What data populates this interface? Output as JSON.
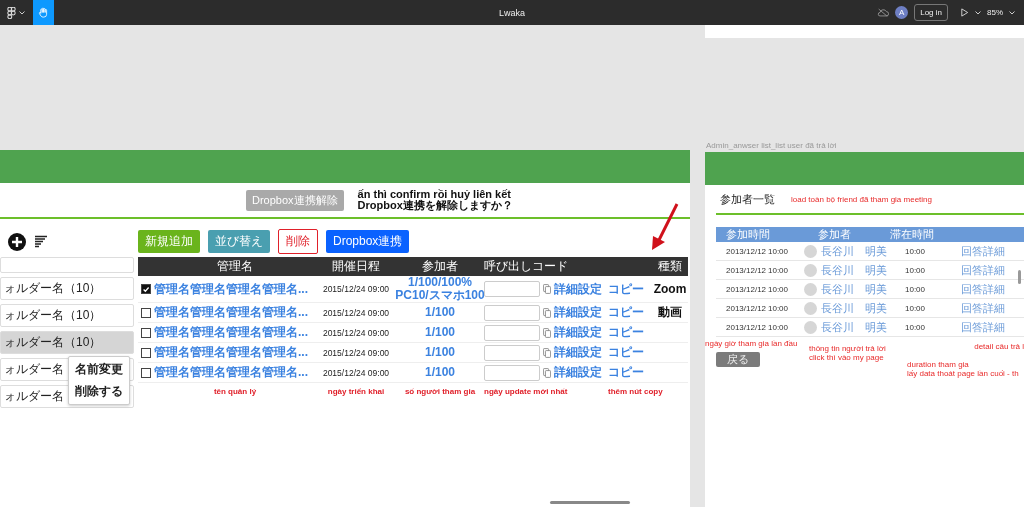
{
  "topbar": {
    "hand_tool": {
      "selected": true
    },
    "title": "Lwaka",
    "avatar": "A",
    "login": "Log in",
    "zoom": "85%"
  },
  "left_frame": {
    "unlink_button": "Dropbox連携解除",
    "note": [
      "ấn thì confirm rồi huỷ liên kết",
      "Dropbox連携を解除しますか？"
    ],
    "actions": [
      {
        "label": "新規追加",
        "kind": "add"
      },
      {
        "label": "並び替え",
        "kind": "sort"
      },
      {
        "label": "削除",
        "kind": "delete"
      },
      {
        "label": "Dropbox連携",
        "kind": "dropbox"
      }
    ],
    "folders": [
      {
        "label": "ォルダー名（10）",
        "selected": false
      },
      {
        "label": "ォルダー名（10）",
        "selected": false
      },
      {
        "label": "ォルダー名（10）",
        "selected": true
      },
      {
        "label": "ォルダー名",
        "selected": false
      },
      {
        "label": "ォルダー名",
        "selected": false
      }
    ],
    "context_menu": [
      "名前変更",
      "削除する"
    ],
    "table": {
      "columns": [
        "管理名",
        "開催日程",
        "参加者",
        "呼び出しコード",
        "種類"
      ],
      "rows": [
        {
          "checked": true,
          "name": "管理名管理名管理名管理名...",
          "date": "2015/12/24 09:00",
          "participants": [
            "1/100/100%",
            "PC10/スマホ100"
          ],
          "settings": "詳細設定",
          "copy": "コピー",
          "type": "Zoom"
        },
        {
          "checked": false,
          "name": "管理名管理名管理名管理名...",
          "date": "2015/12/24 09:00",
          "participants": [
            "1/100"
          ],
          "settings": "詳細設定",
          "copy": "コピー",
          "type": "動画"
        },
        {
          "checked": false,
          "name": "管理名管理名管理名管理名...",
          "date": "2015/12/24 09:00",
          "participants": [
            "1/100"
          ],
          "settings": "詳細設定",
          "copy": "コピー"
        },
        {
          "checked": false,
          "name": "管理名管理名管理名管理名...",
          "date": "2015/12/24 09:00",
          "participants": [
            "1/100"
          ],
          "settings": "詳細設定",
          "copy": "コピー"
        },
        {
          "checked": false,
          "name": "管理名管理名管理名管理名...",
          "date": "2015/12/24 09:00",
          "participants": [
            "1/100"
          ],
          "settings": "詳細設定",
          "copy": "コピー"
        }
      ]
    },
    "annotations": [
      "tên quản lý",
      "ngày triển khai",
      "số người tham gia",
      "ngày update mới nhất",
      "thêm nút copy"
    ]
  },
  "right_frame": {
    "label": "Admin_anwser list_list user đã trả lời",
    "title": "参加者一覧",
    "note": "load toàn bộ friend đã tham gia meeting",
    "columns": [
      "参加時間",
      "参加者",
      "滞在時間"
    ],
    "rows": [
      {
        "date": "2013/12/12",
        "time": "10:00",
        "name": "長谷川　明美",
        "duration": "10:00",
        "detail": "回答詳細"
      },
      {
        "date": "2013/12/12",
        "time": "10:00",
        "name": "長谷川　明美",
        "duration": "10:00",
        "detail": "回答詳細"
      },
      {
        "date": "2013/12/12",
        "time": "10:00",
        "name": "長谷川　明美",
        "duration": "10:00",
        "detail": "回答詳細"
      },
      {
        "date": "2013/12/12",
        "time": "10:00",
        "name": "長谷川　明美",
        "duration": "10:00",
        "detail": "回答詳細"
      },
      {
        "date": "2013/12/12",
        "time": "10:00",
        "name": "長谷川　明美",
        "duration": "10:00",
        "detail": "回答詳細"
      }
    ],
    "back_button": "戻る",
    "annotations": [
      [
        "ngày giờ tham gia lần đầu"
      ],
      [
        "thông tin người trả lời",
        "click thì vào my page"
      ],
      [
        "detail câu trả l"
      ],
      [
        "duration tham gia",
        "lấy data thoát page lần cuối  - th"
      ]
    ]
  }
}
